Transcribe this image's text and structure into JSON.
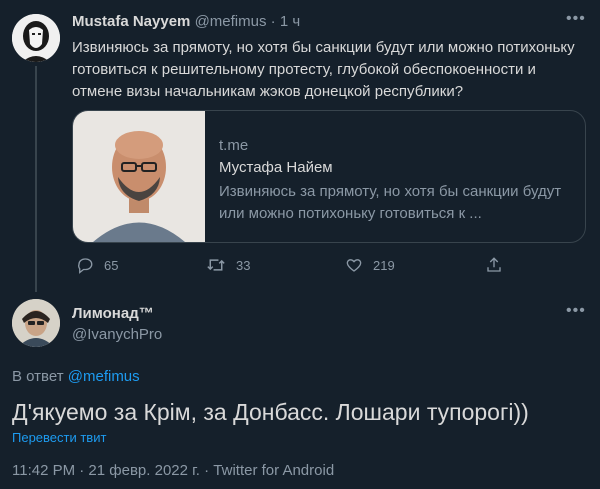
{
  "parent": {
    "name": "Mustafa Nayyem",
    "handle": "@mefimus",
    "separator": "·",
    "time": "1 ч",
    "text": "Извиняюсь за прямоту, но хотя бы санкции будут или можно потихоньку готовиться к решительному протесту, глубокой обеспокоенности и отмене визы начальникам жэков донецкой республики?",
    "card": {
      "domain": "t.me",
      "title": "Мустафа Найем",
      "description": "Извиняюсь за прямоту, но хотя бы санкции будут или можно потихоньку готовиться к ..."
    },
    "actions": {
      "replies": "65",
      "retweets": "33",
      "likes": "219"
    }
  },
  "reply": {
    "name": "Лимонад™",
    "handle": "@IvanychPro",
    "reply_prefix": "В ответ",
    "reply_mention": "@mefimus",
    "text": "Д'якуемо за Крім, за Донбасс. Лошари тупорогі))",
    "translate_label": "Перевести твит",
    "meta": "11:42 PM · 21 февр. 2022 г. · Twitter for Android"
  },
  "colors": {
    "background": "#15202b",
    "text": "#d9d9d9",
    "secondary": "#8b98a5",
    "accent": "#1d9bf0",
    "border": "#38444d"
  },
  "icons": [
    "more-icon",
    "reply-icon",
    "retweet-icon",
    "like-icon",
    "share-icon"
  ]
}
